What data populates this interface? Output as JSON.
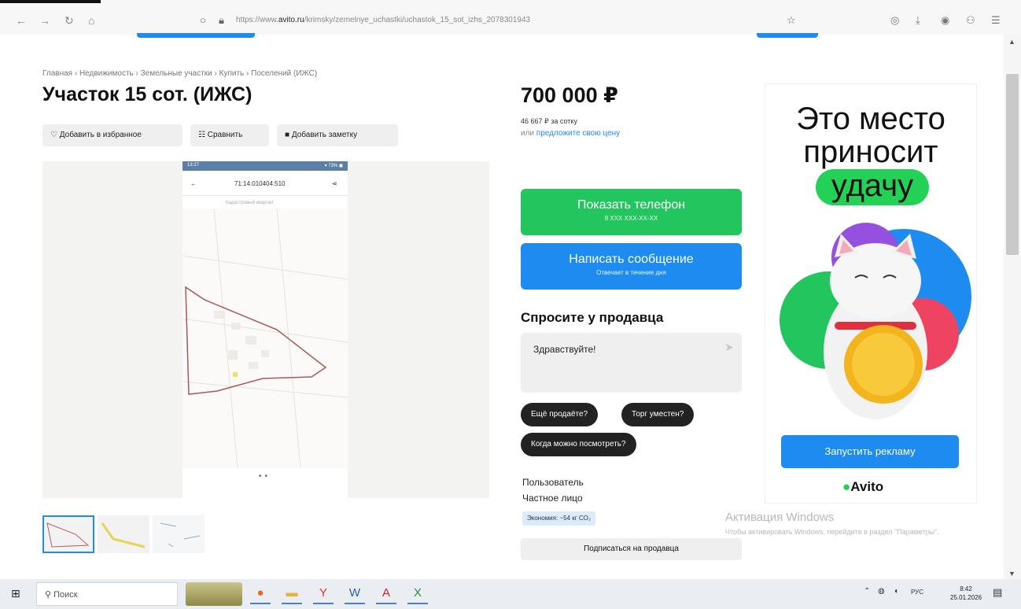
{
  "browser": {
    "url_prefix": "https://www.",
    "url_domain": "avito.ru",
    "url_path": "/krimsky/zemelnye_uchastki/uchastok_15_sot_izhs_2078301943"
  },
  "breadcrumbs": "Главная › Недвижимость › Земельные участки › Купить › Поселений (ИЖС)",
  "listing": {
    "title": "Участок 15 сот. (ИЖС)",
    "price": "700 000 ₽",
    "price_per": "46 667 ₽ за сотку",
    "offer_prefix": "или",
    "offer_link": "предложите свою цену"
  },
  "actions": {
    "favorite": "♡ Добавить в избранное",
    "compare": "☷ Сравнить",
    "note": "■ Добавить заметку"
  },
  "phone_screenshot": {
    "status_left": "13:27",
    "status_right": "▾ 73% ◼",
    "cadastral": "71:14:010404:510",
    "subtitle": "Кадастровый квартал"
  },
  "buttons": {
    "show_phone": "Показать телефон",
    "phone_mask": "8 XXX XXX-XX-XX",
    "write_message": "Написать сообщение",
    "reply_time": "Отвечает в течение дня"
  },
  "ask": {
    "title": "Спросите у продавца",
    "message": "Здравствуйте!",
    "chips": [
      "Ещё продаёте?",
      "Торг уместен?",
      "Когда можно посмотреть?"
    ]
  },
  "seller": {
    "label": "Пользователь",
    "type": "Частное лицо",
    "eco": "Экономия: ~54 кг CO₂",
    "subscribe": "Подписаться на продавца"
  },
  "ad": {
    "line1": "Это место",
    "line2": "приносит",
    "line3": "удачу",
    "button": "Запустить рекламу",
    "brand": "Avito"
  },
  "windows": {
    "activation_title": "Активация Windows",
    "activation_text": "Чтобы активировать Windows, перейдите в раздел \"Параметры\".",
    "search": "Поиск",
    "lang": "РУС",
    "time": "8:42",
    "date": "25.01.2026"
  },
  "colors": {
    "green": "#22c55e",
    "blue": "#1e8bf0",
    "dark": "#222222"
  }
}
